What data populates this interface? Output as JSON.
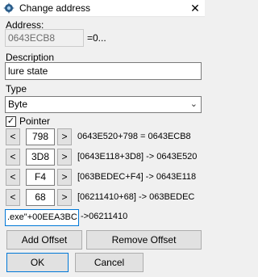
{
  "window": {
    "title": "Change address",
    "close_icon": "close-icon"
  },
  "address": {
    "label": "Address:",
    "value": "0643ECB8",
    "suffix": "=0..."
  },
  "description": {
    "label": "Description",
    "value": "lure state"
  },
  "type": {
    "label": "Type",
    "selected": "Byte"
  },
  "pointer": {
    "label": "Pointer",
    "checked": true,
    "offsets": [
      {
        "dec": "<",
        "inc": ">",
        "value": "798",
        "result": "0643E520+798 = 0643ECB8"
      },
      {
        "dec": "<",
        "inc": ">",
        "value": "3D8",
        "result": "[0643E118+3D8] -> 0643E520"
      },
      {
        "dec": "<",
        "inc": ">",
        "value": "F4",
        "result": "[063BEDEC+F4] -> 0643E118"
      },
      {
        "dec": "<",
        "inc": ">",
        "value": "68",
        "result": "[06211410+68] -> 063BEDEC"
      }
    ],
    "base_address": ".exe\"+00EEA3BC",
    "base_result": "->06211410"
  },
  "buttons": {
    "add_offset": "Add Offset",
    "remove_offset": "Remove Offset",
    "ok": "OK",
    "cancel": "Cancel"
  }
}
